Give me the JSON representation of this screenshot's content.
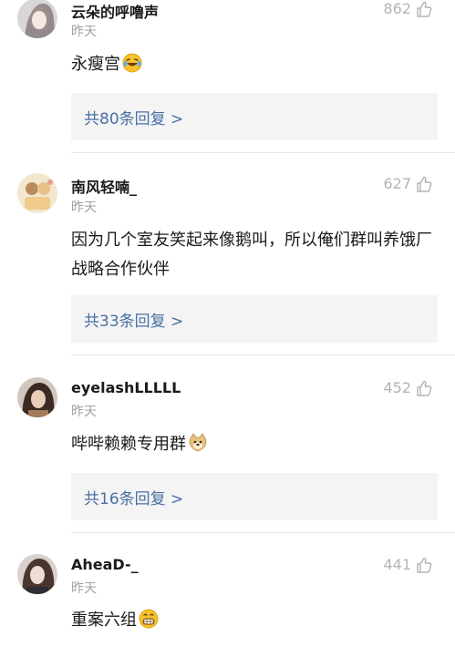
{
  "comments": [
    {
      "username": "云朵的呼噜声",
      "time": "昨天",
      "likes": "862",
      "text": "永瘦宫",
      "emoji": "laugh-crying-emoji",
      "reply_label": "共80条回复 >"
    },
    {
      "username": "南风轻喃_",
      "time": "昨天",
      "likes": "627",
      "text": "因为几个室友笑起来像鹅叫，所以俺们群叫养饿厂战略合作伙伴",
      "emoji": "",
      "reply_label": "共33条回复 >"
    },
    {
      "username": "eyelashLLLLL",
      "time": "昨天",
      "likes": "452",
      "text": "哔哔赖赖专用群",
      "emoji": "doge-emoji",
      "reply_label": "共16条回复 >"
    },
    {
      "username": "AheaD-_",
      "time": "昨天",
      "likes": "441",
      "text": "重案六组",
      "emoji": "grin-emoji",
      "reply_label": ""
    }
  ],
  "colors": {
    "link": "#4a6fa3",
    "muted": "#a0a0a0",
    "reply_bg": "#f4f4f5"
  }
}
